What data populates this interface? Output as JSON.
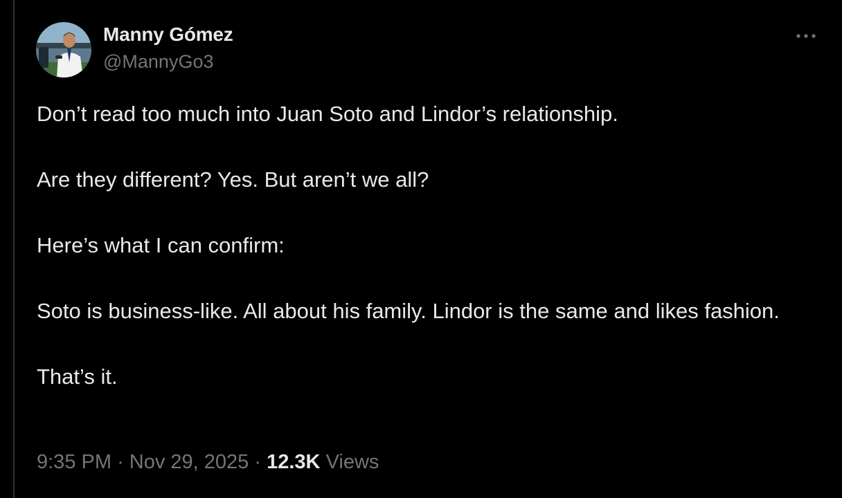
{
  "author": {
    "display_name": "Manny Gómez",
    "handle": "@MannyGo3",
    "avatar_icon": "user-avatar"
  },
  "more_icon": "ellipsis-icon",
  "tweet": {
    "paragraphs": [
      "Don’t read too much into Juan Soto and Lindor’s relationship.",
      "Are they different? Yes. But aren’t we all?",
      "Here’s what I can confirm:",
      "Soto is business-like. All about his family. Lindor is the same and likes fashion.",
      "That’s it."
    ]
  },
  "meta": {
    "time": "9:35 PM",
    "separator": "·",
    "date": "Nov 29, 2025",
    "views_count": "12.3K",
    "views_label": "Views"
  },
  "colors": {
    "background": "#000000",
    "primary_text": "#e7e9ea",
    "secondary_text": "#71767b",
    "divider": "#2f3336"
  }
}
